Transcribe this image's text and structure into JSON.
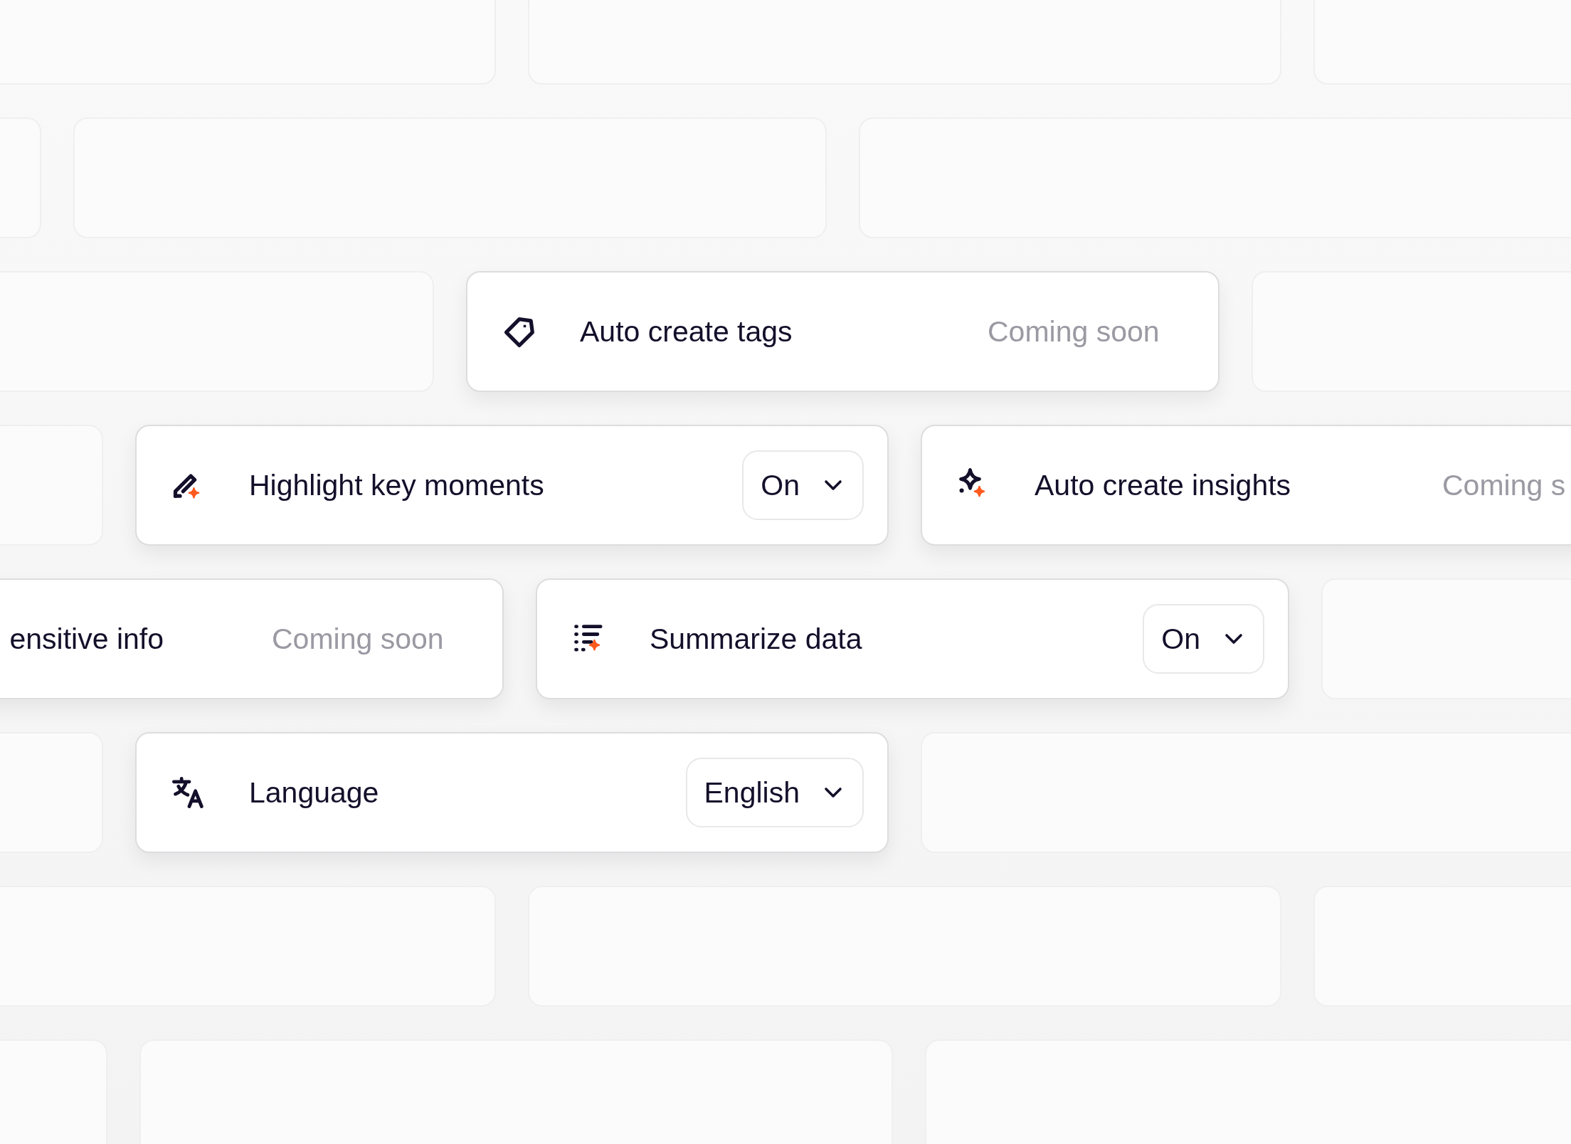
{
  "rows": [
    {
      "cards": [
        {
          "kind": "blank"
        },
        {
          "kind": "blank"
        },
        {
          "kind": "blank"
        }
      ]
    },
    {
      "cards": [
        {
          "kind": "blank"
        },
        {
          "kind": "blank"
        },
        {
          "kind": "blank"
        }
      ]
    },
    {
      "cards": [
        {
          "kind": "blank"
        },
        {
          "kind": "feature",
          "label": "Auto create tags",
          "control": {
            "kind": "status",
            "text": "Coming soon"
          }
        },
        {
          "kind": "blank"
        }
      ]
    },
    {
      "cards": [
        {
          "kind": "blank"
        },
        {
          "kind": "feature",
          "label": "Highlight key moments",
          "control": {
            "kind": "dropdown",
            "value": "On"
          }
        },
        {
          "kind": "feature",
          "label": "Auto create insights",
          "control": {
            "kind": "status",
            "text": "Coming s"
          }
        }
      ]
    },
    {
      "cards": [
        {
          "kind": "cut",
          "label": "ensitive info",
          "control": {
            "kind": "status",
            "text": "Coming soon"
          }
        },
        {
          "kind": "feature",
          "label": "Summarize data",
          "control": {
            "kind": "dropdown",
            "value": "On"
          }
        },
        {
          "kind": "blank"
        }
      ]
    },
    {
      "cards": [
        {
          "kind": "blank"
        },
        {
          "kind": "feature",
          "label": "Language",
          "control": {
            "kind": "dropdown",
            "value": "English"
          }
        },
        {
          "kind": "blank"
        }
      ]
    },
    {
      "cards": [
        {
          "kind": "blank"
        },
        {
          "kind": "blank"
        },
        {
          "kind": "blank"
        }
      ]
    },
    {
      "cards": [
        {
          "kind": "blank"
        },
        {
          "kind": "blank"
        },
        {
          "kind": "blank"
        }
      ]
    }
  ]
}
